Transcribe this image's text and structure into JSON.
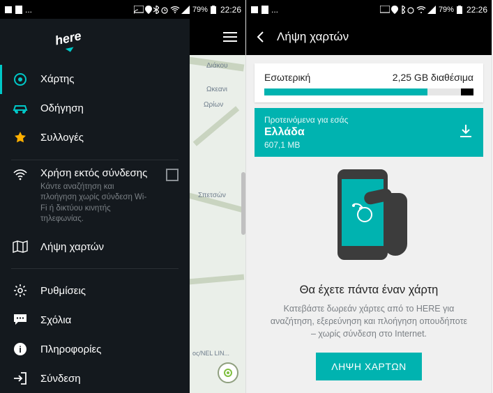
{
  "status": {
    "ellipsis": "...",
    "signal": "79%",
    "time": "22:26"
  },
  "left": {
    "nav": {
      "maps": "Χάρτης",
      "drive": "Οδήγηση",
      "collections": "Συλλογές",
      "offline_title": "Χρήση εκτός σύνδεσης",
      "offline_desc": "Κάντε αναζήτηση και πλοήγηση χωρίς σύνδεση Wi-Fi ή δικτύου κινητής τηλεφωνίας.",
      "download": "Λήψη χαρτών",
      "settings": "Ρυθμίσεις",
      "feedback": "Σχόλια",
      "about": "Πληροφορίες",
      "signin": "Σύνδεση"
    },
    "map": {
      "l1": "Διάκου",
      "l2": "Ωκεανι",
      "l3": "Ωρίων",
      "l4": "Σπετσών",
      "l5": "ος/NEL LIN..."
    }
  },
  "right": {
    "title": "Λήψη χαρτών",
    "storage": {
      "name": "Εσωτερική",
      "avail": "2,25 GB διαθέσιμα"
    },
    "reco": {
      "head": "Προτεινόμενα για εσάς",
      "country": "Ελλάδα",
      "size": "607,1 MB"
    },
    "promo": {
      "title": "Θα έχετε πάντα έναν χάρτη",
      "desc": "Κατεβάστε δωρεάν χάρτες από το HERE για αναζήτηση, εξερεύνηση και πλοήγηση οπουδήποτε – χωρίς σύνδεση στο Internet.",
      "btn": "ΛΗΨΗ ΧΑΡΤΩΝ"
    }
  }
}
